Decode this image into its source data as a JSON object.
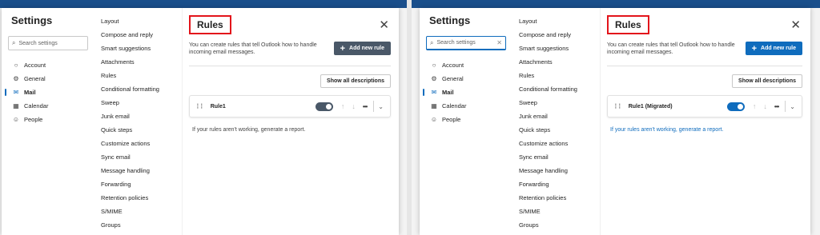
{
  "settings_title": "Settings",
  "search_placeholder": "Search settings",
  "categories": [
    {
      "label": "Account",
      "icon": "person-icon"
    },
    {
      "label": "General",
      "icon": "gear-icon"
    },
    {
      "label": "Mail",
      "icon": "mail-icon",
      "active": true
    },
    {
      "label": "Calendar",
      "icon": "calendar-icon"
    },
    {
      "label": "People",
      "icon": "people-icon"
    }
  ],
  "mail_subitems": [
    "Layout",
    "Compose and reply",
    "Smart suggestions",
    "Attachments",
    "Rules",
    "Conditional formatting",
    "Sweep",
    "Junk email",
    "Quick steps",
    "Customize actions",
    "Sync email",
    "Message handling",
    "Forwarding",
    "Retention policies",
    "S/MIME",
    "Groups"
  ],
  "panels": [
    {
      "rules_title": "Rules",
      "description": "You can create rules that tell Outlook how to handle incoming email messages.",
      "add_rule_label": "Add new rule",
      "add_rule_color": "#4a5868",
      "show_descriptions_label": "Show all descriptions",
      "rule_name": "Rule1",
      "toggle_on": true,
      "toggle_color": "#4a5868",
      "report_text": "If your rules aren't working, generate a report.",
      "report_color": "#424242"
    },
    {
      "rules_title": "Rules",
      "description": "You can create rules that tell Outlook how to handle incoming email messages.",
      "add_rule_label": "Add new rule",
      "add_rule_color": "#0f6cbd",
      "show_descriptions_label": "Show all descriptions",
      "rule_name": "Rule1 (Migrated)",
      "toggle_on": true,
      "toggle_color": "#0f6cbd",
      "report_text": "If your rules aren't working, generate a report.",
      "report_color": "#0f6cbd"
    }
  ]
}
